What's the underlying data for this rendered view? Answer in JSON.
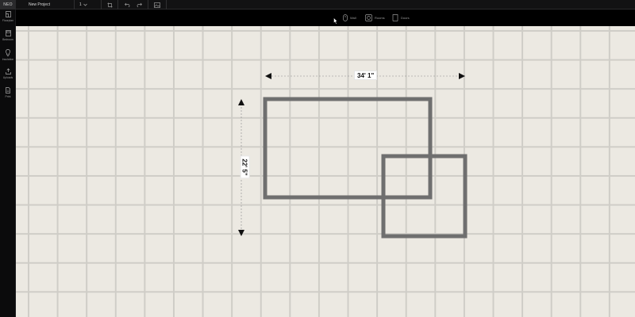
{
  "app": {
    "logo": "NEO",
    "project_name": "New Project",
    "zoom_value": "1"
  },
  "icons": {
    "zoom_chevron": "chevron-down-icon",
    "top_buttons": [
      "crop-icon",
      "undo-icon",
      "redo-icon",
      "image-icon"
    ],
    "toolbar": [
      "wall-icon",
      "rooms-icon",
      "doors-icon"
    ],
    "sidebar": [
      "floorplan-icon",
      "bedroom-icon",
      "insulation-icon",
      "uploads-icon",
      "print-icon"
    ]
  },
  "toolbar": {
    "items": [
      {
        "label": "Wall",
        "icon": "wall-icon"
      },
      {
        "label": "Rooms",
        "icon": "rooms-icon"
      },
      {
        "label": "Doors",
        "icon": "doors-icon"
      }
    ]
  },
  "sidebar": {
    "items": [
      {
        "label": "Floorplan",
        "icon": "floorplan-icon"
      },
      {
        "label": "Bedroom",
        "icon": "bedroom-icon"
      },
      {
        "label": "Insulation",
        "icon": "insulation-icon"
      },
      {
        "label": "Uploads",
        "icon": "uploads-icon"
      },
      {
        "label": "Print",
        "icon": "print-icon"
      }
    ]
  },
  "canvas": {
    "width_dimension": "34' 1\"",
    "height_dimension": "22' 5\"",
    "colors": {
      "background": "#ece9e2",
      "grid_line": "#cfcdc7",
      "room_wall": "#6f6f6f",
      "arrow": "#111111"
    }
  }
}
